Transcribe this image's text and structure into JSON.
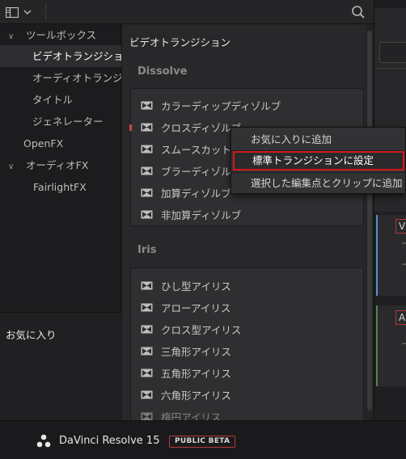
{
  "toolbar": {
    "panel_icon": "panel-layout-icon",
    "dropdown_icon": "chevron-down-icon",
    "search_icon": "search-icon"
  },
  "sidebar": {
    "items": [
      {
        "label": "ツールボックス",
        "expanded": true,
        "selected": false
      },
      {
        "label": "ビデオトランジション",
        "selected": true
      },
      {
        "label": "オーディオトランジ...",
        "selected": false
      },
      {
        "label": "タイトル",
        "selected": false
      },
      {
        "label": "ジェネレーター",
        "selected": false
      },
      {
        "label": "OpenFX",
        "selected": false
      },
      {
        "label": "オーディオFX",
        "expanded": true,
        "selected": false
      },
      {
        "label": "FairlightFX",
        "selected": false
      }
    ],
    "favorites_label": "お気に入り"
  },
  "main": {
    "title": "ビデオトランジション",
    "sections": [
      {
        "name": "Dissolve",
        "items": [
          "カラーディップディゾルブ",
          "クロスディゾルブ",
          "スムースカット",
          "ブラーディゾルブ",
          "加算ディゾルブ",
          "非加算ディゾルブ"
        ]
      },
      {
        "name": "Iris",
        "items": [
          "ひし型アイリス",
          "アローアイリス",
          "クロス型アイリス",
          "三角形アイリス",
          "五角形アイリス",
          "六角形アイリス",
          "楕円アイリス"
        ]
      }
    ]
  },
  "context_menu": {
    "items": [
      "お気に入りに追加",
      "標準トランジションに設定",
      "選択した編集点とクリップに追加"
    ],
    "highlighted_index": 1,
    "highlight_color": "#d11a1a"
  },
  "right_panel": {
    "track_v": "V",
    "track_a": "A"
  },
  "footer": {
    "product": "DaVinci Resolve 15",
    "badge": "PUBLIC BETA",
    "badge_color": "#b73a3a"
  }
}
